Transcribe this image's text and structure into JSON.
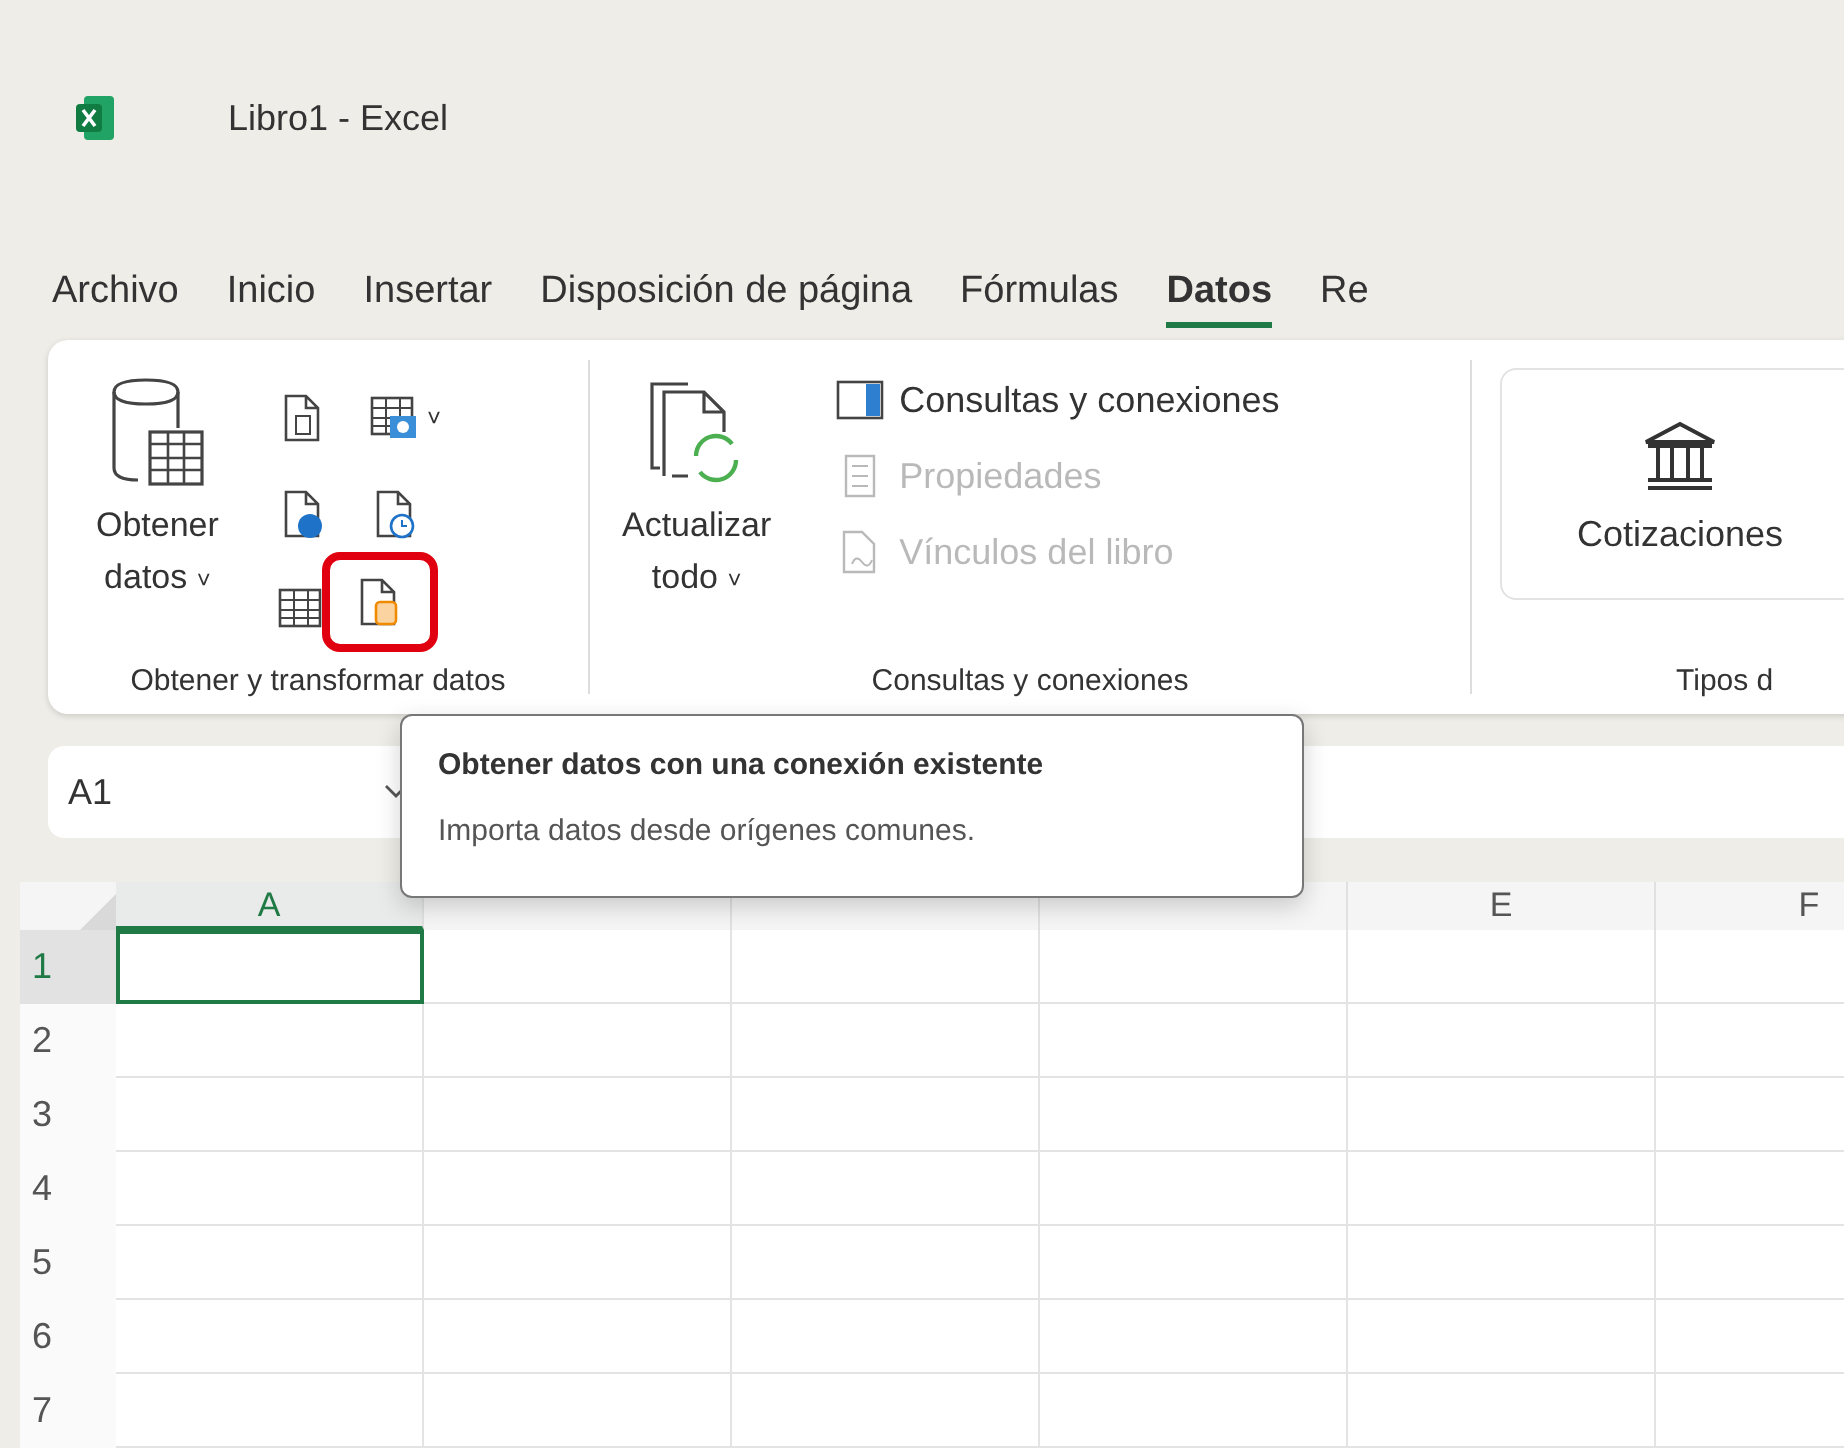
{
  "window": {
    "title": "Libro1  -  Excel"
  },
  "tabs": [
    {
      "label": "Archivo",
      "selected": false
    },
    {
      "label": "Inicio",
      "selected": false
    },
    {
      "label": "Insertar",
      "selected": false
    },
    {
      "label": "Disposición de página",
      "selected": false
    },
    {
      "label": "Fórmulas",
      "selected": false
    },
    {
      "label": "Datos",
      "selected": true
    },
    {
      "label": "Re",
      "selected": false
    }
  ],
  "ribbon": {
    "groups": [
      {
        "label": "Obtener y transformar datos",
        "large_button": {
          "lines": [
            "Obtener",
            "datos"
          ],
          "caret": "˅"
        },
        "small_buttons": [
          {
            "highlighted": false
          },
          {
            "highlighted": false,
            "caret": "˅"
          },
          {
            "highlighted": false
          },
          {
            "highlighted": false
          },
          {
            "highlighted": false
          },
          {
            "highlighted": true
          }
        ]
      },
      {
        "label": "Consultas y conexiones",
        "large_button": {
          "lines": [
            "Actualizar",
            "todo"
          ],
          "caret": "˅"
        },
        "list_buttons": [
          {
            "label": "Consultas y conexiones",
            "disabled": false
          },
          {
            "label": "Propiedades",
            "disabled": true
          },
          {
            "label": "Vínculos del libro",
            "disabled": true
          }
        ]
      },
      {
        "label": "Tipos d",
        "card_button": {
          "label": "Cotizaciones"
        }
      }
    ]
  },
  "name_box": {
    "value": "A1"
  },
  "tooltip": {
    "title": "Obtener datos con una conexión existente",
    "body": "Importa datos desde orígenes comunes."
  },
  "sheet": {
    "columns": [
      {
        "label": "A",
        "selected": true
      },
      {
        "selected": false
      },
      {
        "selected": false
      },
      {
        "selected": false
      },
      {
        "label": "E",
        "selected": false
      },
      {
        "label": "F",
        "selected": false
      }
    ],
    "rows": [
      {
        "label": "1",
        "selected": true
      },
      {
        "label": "2",
        "selected": false
      },
      {
        "label": "3",
        "selected": false
      },
      {
        "label": "4",
        "selected": false
      },
      {
        "label": "5",
        "selected": false
      },
      {
        "label": "6",
        "selected": false
      },
      {
        "label": "7",
        "selected": false
      }
    ]
  }
}
